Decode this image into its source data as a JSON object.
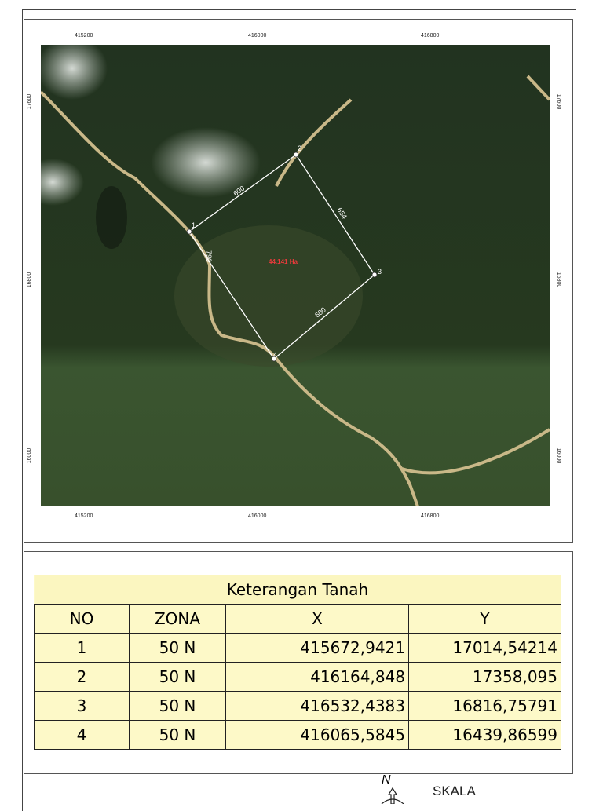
{
  "map": {
    "x_ticks": [
      "415200",
      "416000",
      "416800"
    ],
    "y_ticks": [
      "17600",
      "16800",
      "16000"
    ],
    "area_label": "44.141 Ha",
    "vertices": [
      "1",
      "2",
      "3",
      "4"
    ],
    "edge_labels": [
      "600",
      "654",
      "600",
      "790"
    ],
    "colors": {
      "boundary": "#ffffff",
      "area_text": "#e83b3b"
    }
  },
  "legend": {
    "title": "Keterangan Tanah",
    "headers": [
      "NO",
      "ZONA",
      "X",
      "Y"
    ],
    "rows": [
      {
        "no": "1",
        "zona": "50 N",
        "x": "415672,9421",
        "y": "17014,54214"
      },
      {
        "no": "2",
        "zona": "50 N",
        "x": "416164,848",
        "y": "17358,095"
      },
      {
        "no": "3",
        "zona": "50 N",
        "x": "416532,4383",
        "y": "16816,75791"
      },
      {
        "no": "4",
        "zona": "50 N",
        "x": "416065,5845",
        "y": "16439,86599"
      }
    ]
  },
  "footer": {
    "north": "N",
    "scale_label": "SKALA"
  }
}
